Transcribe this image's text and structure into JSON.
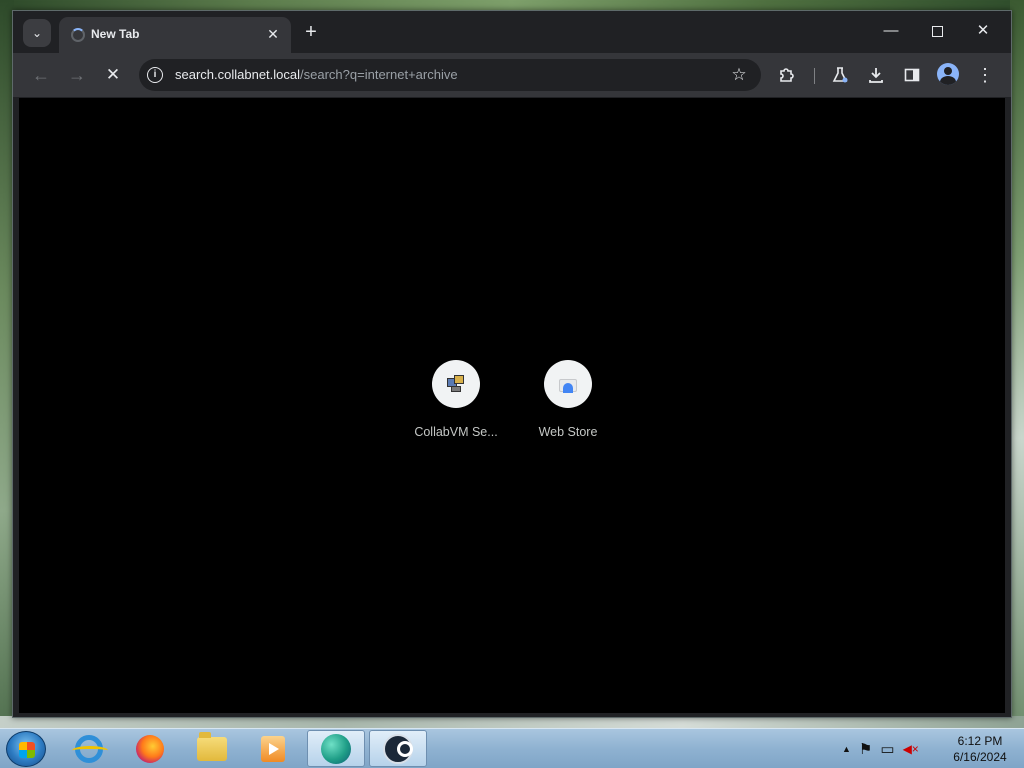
{
  "browser": {
    "tab": {
      "title": "New Tab"
    },
    "window_controls": {
      "minimize": "—",
      "maximize": "",
      "close": "✕"
    },
    "toolbar": {
      "back_icon": "←",
      "forward_icon": "→",
      "stop_icon": "✕",
      "url_host": "search.collabnet.local",
      "url_path": "/search?q=internet+archive",
      "info_icon": "i",
      "star_icon": "☆"
    },
    "shortcuts": [
      {
        "label": "CollabVM Se..."
      },
      {
        "label": "Web Store"
      }
    ],
    "colors": {
      "frame": "#202124",
      "toolbar": "#35363a",
      "content": "#000000",
      "accent": "#8ab4f8"
    }
  },
  "taskbar": {
    "apps": [
      {
        "name": "Internet Explorer"
      },
      {
        "name": "Firefox"
      },
      {
        "name": "Windows Explorer"
      },
      {
        "name": "Windows Media Player"
      },
      {
        "name": "Microsoft Edge"
      },
      {
        "name": "Steam"
      }
    ],
    "tray": {
      "show_hidden": "▲",
      "flag": "⚑",
      "network": "▭",
      "volume": "◀×"
    },
    "clock": {
      "time": "6:12 PM",
      "date": "6/16/2024"
    }
  }
}
